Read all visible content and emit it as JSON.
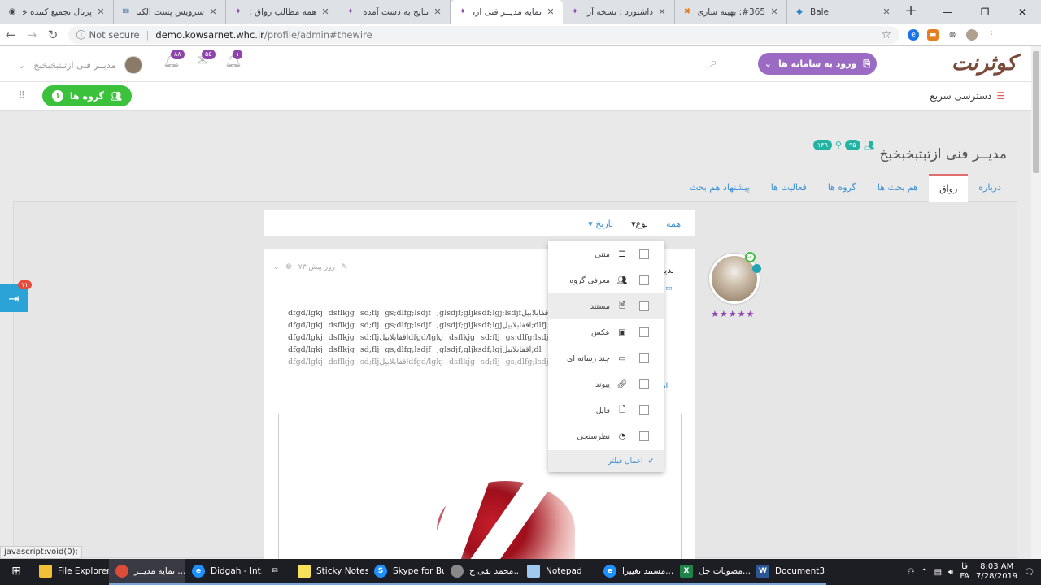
{
  "browser": {
    "tabs": [
      {
        "title": "پرتال تجمیع کننده خد",
        "active": false
      },
      {
        "title": "سرویس پست الکترون",
        "active": false
      },
      {
        "title": "همه مطالب رواق : نم",
        "active": false
      },
      {
        "title": "نتایج به دست آمده برا",
        "active": false
      },
      {
        "title": "نمایه مدیــر فنی ازتبـ",
        "active": true
      },
      {
        "title": "داشبورد : نسخه آزمای",
        "active": false
      },
      {
        "title": "#365: بهینه سازی نما",
        "active": false
      },
      {
        "title": "Bale",
        "active": false
      }
    ],
    "not_secure": "Not secure",
    "url_host": "demo.kowsarnet.whc.ir",
    "url_path": "/profile/admin#thewire"
  },
  "header": {
    "logo": "کوثرنت",
    "enter_system": "ورود به سامانه ها",
    "badge_notifications": "۱",
    "badge_messages": "۵۵",
    "badge_alerts": "۸۸",
    "user_name": "مدیــر فنی ازتبتبخبخبخ"
  },
  "quick": {
    "quick_access": "دسترسی سریع",
    "groups_btn": "گروه ها",
    "groups_count": "۱"
  },
  "profile": {
    "name": "مدیــر فنی ازتبتبخبخبخ",
    "stat_followers": "۹۵",
    "stat_following": "۱۳۹",
    "tabs": [
      "درباره",
      "رواق",
      "هم بحث ها",
      "گروه ها",
      "فعالیت ها",
      "پیشنهاد هم بحث"
    ],
    "active_tab": "رواق"
  },
  "filter": {
    "all": "همه",
    "type": "نوع",
    "date": "تاریخ"
  },
  "dropdown": {
    "items": [
      {
        "label": "متنی",
        "icon": "text-icon"
      },
      {
        "label": "معرفی گروه",
        "icon": "group-icon"
      },
      {
        "label": "مستند",
        "icon": "document-icon"
      },
      {
        "label": "عکس",
        "icon": "image-icon"
      },
      {
        "label": "چند رسانه ای",
        "icon": "video-icon"
      },
      {
        "label": "پیوند",
        "icon": "link-icon"
      },
      {
        "label": "فایل",
        "icon": "file-icon"
      },
      {
        "label": "نظرسنجی",
        "icon": "poll-icon"
      }
    ],
    "apply": "اعمال فیلتر"
  },
  "post": {
    "time": "۷۳ روز پیش",
    "author": "مدیـ",
    "cut": "اد",
    "lines": [
      "dfgd/lgkj   dsflkjg   sd;flj   gs;dlfg;lsdjf   ;glsdjf;gljksdf;lgj;lsdjfاقفابلابیل",
      "dfgd/lgkj   dsflkjg   sd;flj   gs;dlfg;lsdjf   ;glsdjf;gljksdf;lgjاقفابلابیل;dlfj",
      "dfgd/lgkj  dsflkjg  sd;fljاقفابلابیلdfgd/lgkj  dsflkjg  sd;flj  gs;dlfg;lsdjf  ;gl",
      "dfgd/lgkj   dsflkjg   sd;flj   gs;dlfg;lsdjf   ;glsdjf;gljksdf;lgjاقفابلابیل;dl",
      "dfgd/lgkj  dsflkjg  sd;fljاقفابلابیلdfgd/lgkj  dsflkjg  sd;flj  gs;dlfg;lsdjf  ;gl"
    ]
  },
  "side_badge": "۱۱",
  "status_url": "javascript:void(0);",
  "taskbar": {
    "items": [
      {
        "label": "File Explorer",
        "color": "#f2c037"
      },
      {
        "label": "نمایه مدیــر ...",
        "color": "#dd4b39"
      },
      {
        "label": "Didgah - Int...",
        "color": "#1e90ff"
      },
      {
        "label": "",
        "color": "#ffffff"
      },
      {
        "label": "Sticky Notes",
        "color": "#f7e15a"
      },
      {
        "label": "Skype for Bu...",
        "color": "#1e90ff"
      },
      {
        "label": "محمد تقی ج...",
        "color": "#888888"
      },
      {
        "label": "Notepad",
        "color": "#9ec9f0"
      },
      {
        "label": "مستند تغییرا...",
        "color": "#1e90ff"
      },
      {
        "label": "مصوبات جل...",
        "color": "#1e8449"
      },
      {
        "label": "Document3 ...",
        "color": "#2b5797"
      }
    ],
    "lang_top": "فا",
    "lang_bottom": "FA",
    "time": "8:03 AM",
    "date": "7/28/2019"
  }
}
